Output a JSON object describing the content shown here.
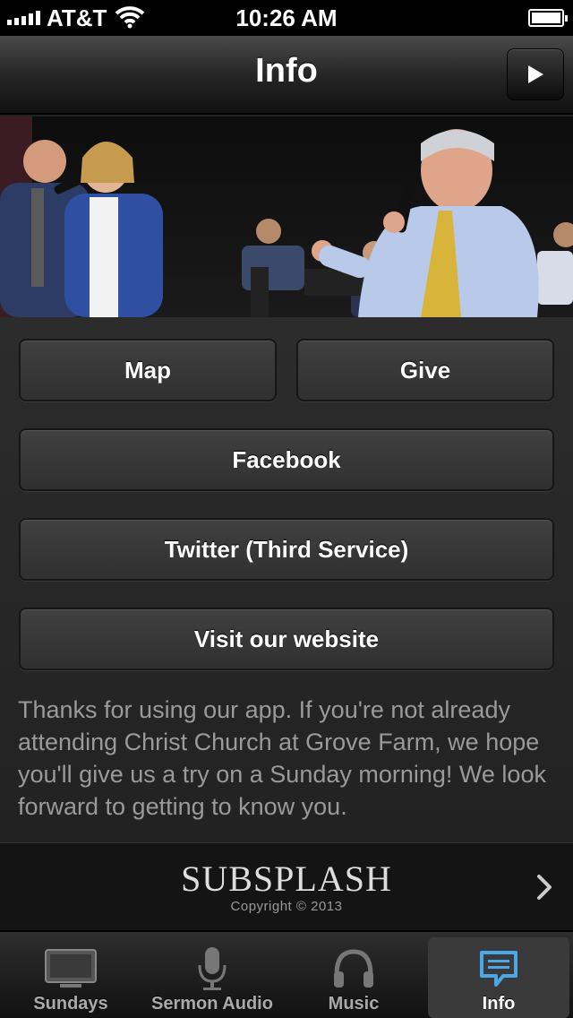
{
  "status_bar": {
    "carrier": "AT&T",
    "time": "10:26 AM",
    "signal_bars": 5,
    "battery_level": 1.0
  },
  "nav": {
    "title": "Info",
    "play_icon": "play-icon"
  },
  "hero": {
    "image": "worship-leaders-singing-photo"
  },
  "buttons": {
    "map": "Map",
    "give": "Give",
    "facebook": "Facebook",
    "twitter": "Twitter (Third Service)",
    "website": "Visit our website"
  },
  "blurb": "Thanks for using our app. If you're not already attending Christ Church at Grove Farm, we hope you'll give us a try on a Sunday morning! We look forward to getting to know you.",
  "branding": {
    "logo": "SUBSPLASH",
    "copyright": "Copyright © 2013"
  },
  "tabs": [
    {
      "label": "Sundays",
      "icon": "tv-icon",
      "active": false
    },
    {
      "label": "Sermon Audio",
      "icon": "microphone-icon",
      "active": false
    },
    {
      "label": "Music",
      "icon": "headphones-icon",
      "active": false
    },
    {
      "label": "Info",
      "icon": "chat-bubble-icon",
      "active": true
    }
  ],
  "colors": {
    "active_tab_icon": "#4aa8e8",
    "background": "#222222"
  }
}
